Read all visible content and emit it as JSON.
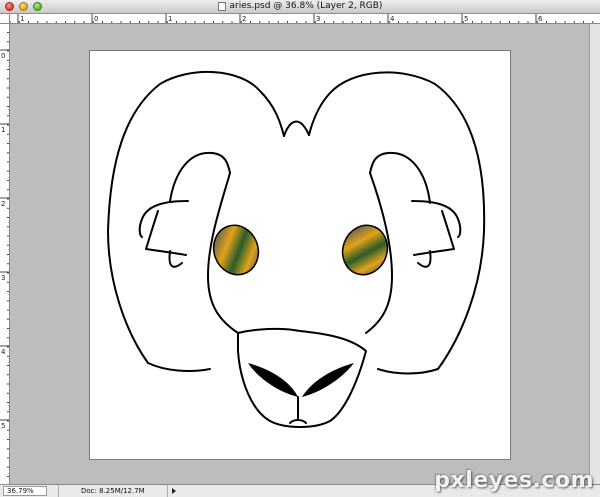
{
  "window": {
    "title": "aries.psd @ 36.8% (Layer 2, RGB)",
    "buttons": [
      "close",
      "minimize",
      "zoom"
    ]
  },
  "rulers": {
    "top_labels": [
      "1",
      "0",
      "1",
      "2",
      "3",
      "4",
      "5",
      "6"
    ],
    "left_labels": [
      "0",
      "1",
      "2",
      "3",
      "4",
      "5"
    ]
  },
  "canvas": {
    "background": "#ffffff",
    "artwork": "ram-head-line-drawing",
    "eye_colors": [
      "#1f3f6e",
      "#e2a21a",
      "#2a5c2a"
    ]
  },
  "statusbar": {
    "zoom": "36.79%",
    "doc_info": "Doc: 8.25M/12.7M"
  },
  "watermark": "pxleyes.com",
  "colors": {
    "workspace": "#bdbdbd",
    "ruler": "#ffffff",
    "outline": "#000000"
  }
}
